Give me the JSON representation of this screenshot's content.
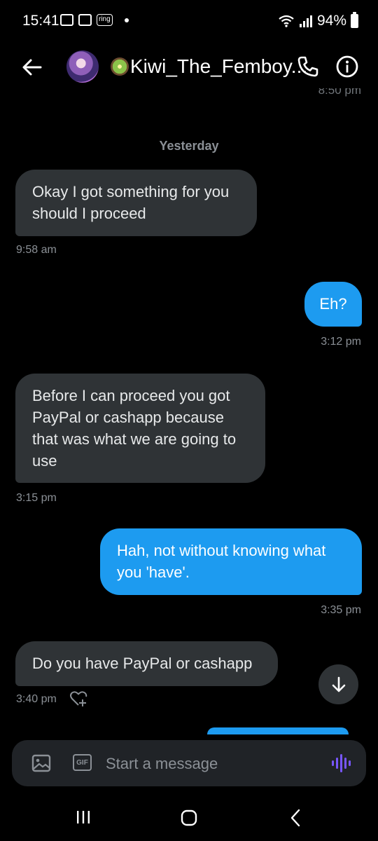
{
  "status_bar": {
    "time": "15:41",
    "ring_label": "ring",
    "battery": "94%"
  },
  "header": {
    "contact_name": "Kiwi_The_Femboy...",
    "previous_time": "8:50 pm"
  },
  "conversation": {
    "day_separator": "Yesterday",
    "messages": [
      {
        "direction": "in",
        "text": "Okay I got something for you should I proceed",
        "time": "9:58 am"
      },
      {
        "direction": "out",
        "text": "Eh?",
        "time": "3:12 pm"
      },
      {
        "direction": "in",
        "text": "Before I can proceed you got PayPal or cashapp because that was what we are going to use",
        "time": "3:15 pm"
      },
      {
        "direction": "out",
        "text": "Hah, not without knowing what you 'have'.",
        "time": "3:35 pm"
      },
      {
        "direction": "in",
        "text": "Do you have PayPal or cashapp",
        "time": "3:40 pm"
      }
    ]
  },
  "composer": {
    "placeholder": "Start a message",
    "gif_label": "GIF"
  },
  "colors": {
    "background": "#000000",
    "incoming_bubble": "#2f3336",
    "outgoing_bubble": "#1d9bf0",
    "voice_accent": "#7856ff"
  },
  "icons": {
    "back": "arrow-left-icon",
    "call": "phone-icon",
    "info": "info-icon",
    "react": "heart-plus-icon",
    "scroll": "arrow-down-icon",
    "media": "image-icon",
    "voice": "waveform-icon"
  }
}
